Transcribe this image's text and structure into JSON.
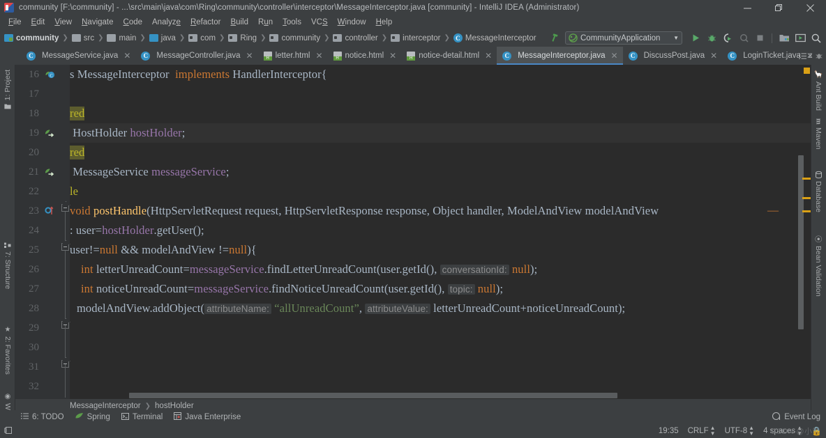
{
  "window": {
    "title": "community [F:\\community] - ...\\src\\main\\java\\com\\Ring\\community\\controller\\interceptor\\MessageInterceptor.java [community] - IntelliJ IDEA (Administrator)",
    "app_icon": "intellij-idea-icon",
    "buttons": {
      "minimize": "minimize-icon",
      "maximize": "maximize-icon",
      "close": "close-icon"
    }
  },
  "menubar": {
    "items": [
      {
        "label": "File"
      },
      {
        "label": "Edit"
      },
      {
        "label": "View"
      },
      {
        "label": "Navigate"
      },
      {
        "label": "Code"
      },
      {
        "label": "Analyze"
      },
      {
        "label": "Refactor"
      },
      {
        "label": "Build"
      },
      {
        "label": "Run"
      },
      {
        "label": "Tools"
      },
      {
        "label": "VCS"
      },
      {
        "label": "Window"
      },
      {
        "label": "Help"
      }
    ]
  },
  "navbar": {
    "breadcrumbs": [
      {
        "label": "community",
        "icon": "module-icon",
        "bold": true
      },
      {
        "label": "src",
        "icon": "folder-icon"
      },
      {
        "label": "main",
        "icon": "folder-icon"
      },
      {
        "label": "java",
        "icon": "source-root-folder-icon"
      },
      {
        "label": "com",
        "icon": "package-icon"
      },
      {
        "label": "Ring",
        "icon": "package-icon"
      },
      {
        "label": "community",
        "icon": "package-icon"
      },
      {
        "label": "controller",
        "icon": "package-icon"
      },
      {
        "label": "interceptor",
        "icon": "package-icon"
      },
      {
        "label": "MessageInterceptor",
        "icon": "class-icon"
      }
    ],
    "run_configuration": "CommunityApplication",
    "toolbar_icons": [
      "build-hammer-icon",
      "run-icon",
      "debug-icon",
      "run-with-coverage-icon",
      "profile-icon",
      "stop-icon",
      "project-structure-icon",
      "update-app-icon",
      "search-everywhere-icon"
    ]
  },
  "tabs": [
    {
      "label": "MessageService.java",
      "icon": "java-class-icon",
      "active": false
    },
    {
      "label": "MessageController.java",
      "icon": "java-class-icon",
      "active": false
    },
    {
      "label": "letter.html",
      "icon": "html-file-icon",
      "active": false
    },
    {
      "label": "notice.html",
      "icon": "html-file-icon",
      "active": false
    },
    {
      "label": "notice-detail.html",
      "icon": "html-file-icon",
      "active": false
    },
    {
      "label": "MessageInterceptor.java",
      "icon": "java-class-icon",
      "active": true
    },
    {
      "label": "DiscussPost.java",
      "icon": "java-class-icon",
      "active": false
    },
    {
      "label": "LoginTicket.java",
      "icon": "java-class-icon",
      "active": false
    }
  ],
  "tabbar_right": {
    "tab_list_count": "2",
    "icon": "tab-list-icon",
    "extra_icon": "debug-bug-icon"
  },
  "left_tool_strip": [
    {
      "label": "1: Project",
      "icon": "project-icon"
    },
    {
      "label": "7: Structure",
      "icon": "structure-icon"
    },
    {
      "label": "2: Favorites",
      "icon": "star-icon"
    },
    {
      "label": "Web",
      "icon": "web-globe-icon"
    }
  ],
  "right_tool_strip": [
    {
      "label": "Ant Build",
      "icon": "ant-icon"
    },
    {
      "label": "Maven",
      "icon": "maven-icon"
    },
    {
      "label": "Database",
      "icon": "database-icon"
    },
    {
      "label": "Bean Validation",
      "icon": "bean-validation-icon"
    }
  ],
  "editor": {
    "line_numbers": [
      "16",
      "17",
      "18",
      "19",
      "20",
      "21",
      "22",
      "23",
      "24",
      "25",
      "26",
      "27",
      "28",
      "29",
      "30",
      "31",
      "32"
    ],
    "lines": [
      {
        "num": "16",
        "gutter": "class-marker-icon",
        "segments": [
          {
            "t": "s ",
            "c": "plain"
          },
          {
            "t": "MessageInterceptor ",
            "c": "plain"
          },
          {
            "t": " implements ",
            "c": "kw"
          },
          {
            "t": "HandlerInterceptor{",
            "c": "plain"
          }
        ]
      },
      {
        "num": "17",
        "gutter": "",
        "segments": []
      },
      {
        "num": "18",
        "gutter": "",
        "segments": [
          {
            "t": "red",
            "c": "annohl"
          }
        ]
      },
      {
        "num": "19",
        "gutter": "implemented-method-icon",
        "segments": [
          {
            "t": " HostHolder ",
            "c": "plain"
          },
          {
            "t": "hostHolder",
            "c": "field"
          },
          {
            "t": ";",
            "c": "plain"
          }
        ]
      },
      {
        "num": "20",
        "gutter": "",
        "segments": [
          {
            "t": "red",
            "c": "annohl"
          }
        ]
      },
      {
        "num": "21",
        "gutter": "implemented-method-icon",
        "segments": [
          {
            "t": " MessageService ",
            "c": "plain"
          },
          {
            "t": "messageService",
            "c": "field"
          },
          {
            "t": ";",
            "c": "plain"
          }
        ]
      },
      {
        "num": "22",
        "gutter": "",
        "segments": [
          {
            "t": "le",
            "c": "anno"
          }
        ]
      },
      {
        "num": "23",
        "gutter": "overriding-method-icon",
        "segments": [
          {
            "t": "void ",
            "c": "kw"
          },
          {
            "t": "postHandle",
            "c": "method"
          },
          {
            "t": "(HttpServletRequest request, HttpServletResponse response, Object handler, ModelAndView modelAndView",
            "c": "plain"
          }
        ]
      },
      {
        "num": "24",
        "gutter": "",
        "segments": [
          {
            "t": ": user=",
            "c": "plain"
          },
          {
            "t": "hostHolder",
            "c": "field"
          },
          {
            "t": ".getUser();",
            "c": "plain"
          }
        ]
      },
      {
        "num": "25",
        "gutter": "",
        "segments": [
          {
            "t": "user!=",
            "c": "plain"
          },
          {
            "t": "null",
            "c": "kw"
          },
          {
            "t": " && modelAndView !=",
            "c": "plain"
          },
          {
            "t": "null",
            "c": "kw"
          },
          {
            "t": "){",
            "c": "plain"
          }
        ]
      },
      {
        "num": "26",
        "gutter": "",
        "segments": [
          {
            "t": "int ",
            "c": "kw"
          },
          {
            "t": "letterUnreadCount=",
            "c": "plain"
          },
          {
            "t": "messageService",
            "c": "field"
          },
          {
            "t": ".findLetterUnreadCount(user.getId(), ",
            "c": "plain"
          },
          {
            "t": "conversationId:",
            "c": "hint"
          },
          {
            "t": " null",
            "c": "kw"
          },
          {
            "t": ");",
            "c": "plain"
          }
        ]
      },
      {
        "num": "27",
        "gutter": "",
        "segments": [
          {
            "t": "int ",
            "c": "kw"
          },
          {
            "t": "noticeUnreadCount=",
            "c": "plain"
          },
          {
            "t": "messageService",
            "c": "field"
          },
          {
            "t": ".findNoticeUnreadCount(user.getId(), ",
            "c": "plain"
          },
          {
            "t": "topic:",
            "c": "hint"
          },
          {
            "t": " null",
            "c": "kw"
          },
          {
            "t": ");",
            "c": "plain"
          }
        ]
      },
      {
        "num": "28",
        "gutter": "",
        "segments": [
          {
            "t": "modelAndView.addObject(",
            "c": "plain"
          },
          {
            "t": "attributeName:",
            "c": "hint"
          },
          {
            "t": " “allUnreadCount”",
            "c": "str"
          },
          {
            "t": ", ",
            "c": "plain"
          },
          {
            "t": "attributeValue:",
            "c": "hint"
          },
          {
            "t": " letterUnreadCount+noticeUnreadCount);",
            "c": "plain"
          }
        ]
      },
      {
        "num": "29",
        "gutter": "",
        "segments": []
      },
      {
        "num": "30",
        "gutter": "",
        "segments": []
      },
      {
        "num": "31",
        "gutter": "",
        "segments": []
      },
      {
        "num": "32",
        "gutter": "",
        "segments": []
      }
    ]
  },
  "status_breadcrumb": {
    "class": "MessageInterceptor",
    "member": "hostHolder"
  },
  "tool_windows": [
    {
      "label": "6: TODO",
      "icon": "todo-icon"
    },
    {
      "label": "Spring",
      "icon": "spring-leaf-icon"
    },
    {
      "label": "Terminal",
      "icon": "terminal-icon"
    },
    {
      "label": "Java Enterprise",
      "icon": "java-enterprise-icon"
    }
  ],
  "event_log": {
    "label": "Event Log",
    "icon": "event-log-icon"
  },
  "statusbar": {
    "left_icon": "memory-indicator-icon",
    "position": "19:35",
    "line_separator": "CRLF",
    "encoding": "UTF-8",
    "indent": "4 spaces",
    "watermark": "CSDN @小熊"
  },
  "colors": {
    "accent_blue": "#4a88c7",
    "keyword_orange": "#cc7832",
    "field_purple": "#9876aa",
    "string_green": "#6a8759",
    "annotation_yellow": "#bbb529",
    "plain_text": "#a9b7c6",
    "editor_bg": "#2b2b2b",
    "chrome_bg": "#3c3f41"
  }
}
